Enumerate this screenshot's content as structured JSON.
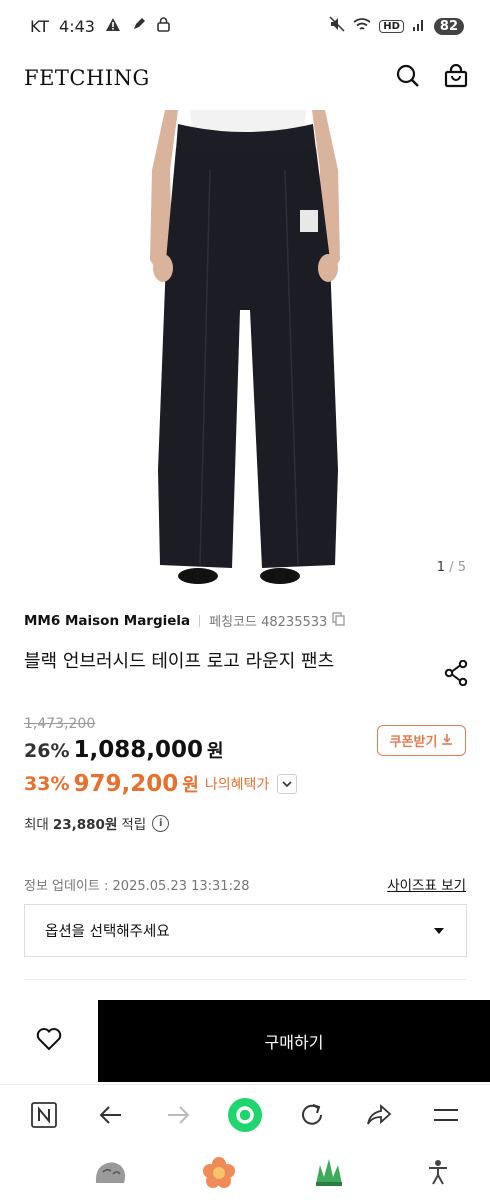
{
  "status": {
    "carrier": "KT",
    "time": "4:43",
    "hd": "HD",
    "battery": "82"
  },
  "header": {
    "logo": "FETCHING"
  },
  "gallery": {
    "current": "1",
    "total": "/ 5"
  },
  "product": {
    "brand": "MM6 Maison Margiela",
    "code_label": "페칭코드 48235533",
    "title": "블랙 언브러시드 테이프 로고 라운지 팬츠"
  },
  "pricing": {
    "original": "1,473,200",
    "discount1": "26%",
    "price1": "1,088,000",
    "won": "원",
    "coupon_label": "쿠폰받기",
    "discount2": "33%",
    "price2": "979,200",
    "benefit_label": "나의혜택가",
    "points_prefix": "최대",
    "points_amount": "23,880원",
    "points_suffix": "적립"
  },
  "meta": {
    "update": "정보 업데이트 : 2025.05.23 13:31:28",
    "size_chart": "사이즈표 보기"
  },
  "option": {
    "placeholder": "옵션을 선택해주세요"
  },
  "cta": {
    "buy": "구매하기"
  },
  "colors": {
    "accent": "#e8702f",
    "coupon": "#e07d52",
    "pants": "#1c1c24"
  }
}
